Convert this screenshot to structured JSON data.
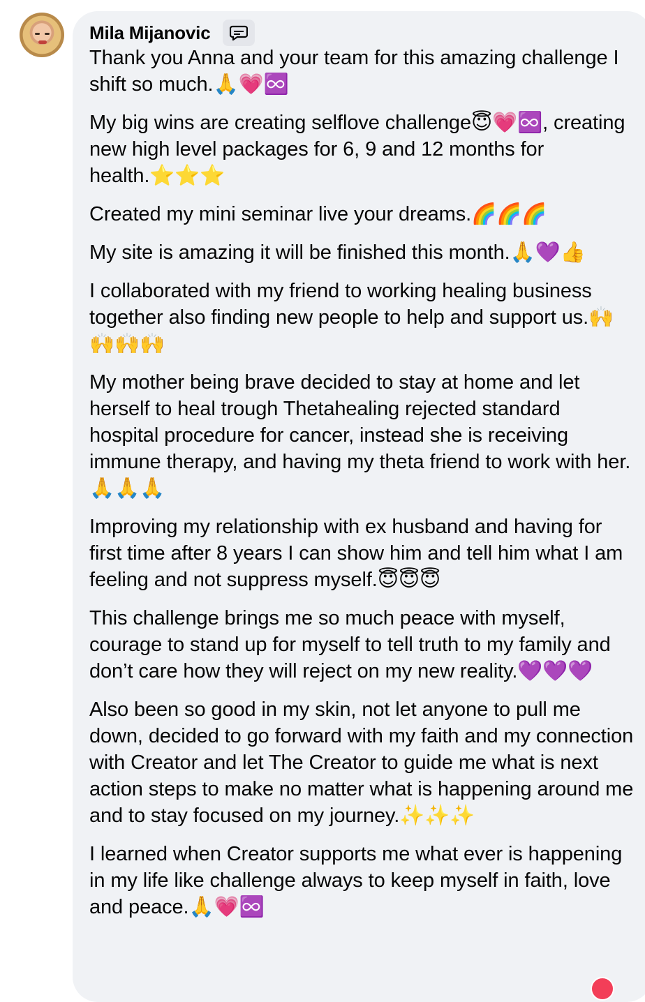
{
  "comment": {
    "author": "Mila Mijanovic",
    "paragraphs": [
      "Thank you Anna and your team for this amazing challenge I shift so much.🙏💗♾️",
      "My big wins are creating selflove challenge😇💗♾️, creating new high level packages for 6, 9 and 12 months for health.⭐⭐⭐",
      "Created my mini seminar live your dreams.🌈🌈🌈",
      "My site is amazing it will be finished this month.🙏💜👍",
      "I collaborated with my friend to working healing business together also finding new people to help and support us.🙌🙌🙌🙌",
      "My mother being brave decided to stay at home and let herself to heal trough Thetahealing rejected standard hospital procedure for cancer, instead she is receiving immune therapy, and having my theta friend to work with her.🙏🙏🙏",
      "Improving my relationship with ex husband and having for first time after 8 years I can show him and tell him what I am feeling and not suppress myself.😇😇😇",
      "This challenge brings me so much peace with myself, courage to stand up for myself to tell truth to my family and don’t care how they will reject on my new reality.💜💜💜",
      "Also been so good in my skin, not let anyone to pull me down, decided to go forward with my faith and my connection with Creator and let The Creator to guide me what is next action steps to make no matter what is happening around me and to stay focused on my journey.✨✨✨",
      "I learned when Creator supports me what ever is happening in my life like challenge always to keep myself in faith, love and peace.🙏💗♾️"
    ],
    "badge_icon": "chat-bubble-icon",
    "reaction_icon": "heart-reaction-icon"
  },
  "colors": {
    "bubble": "#f0f2f5",
    "text": "#050505",
    "badge": "#e4e6eb",
    "reaction": "#f33e58"
  }
}
